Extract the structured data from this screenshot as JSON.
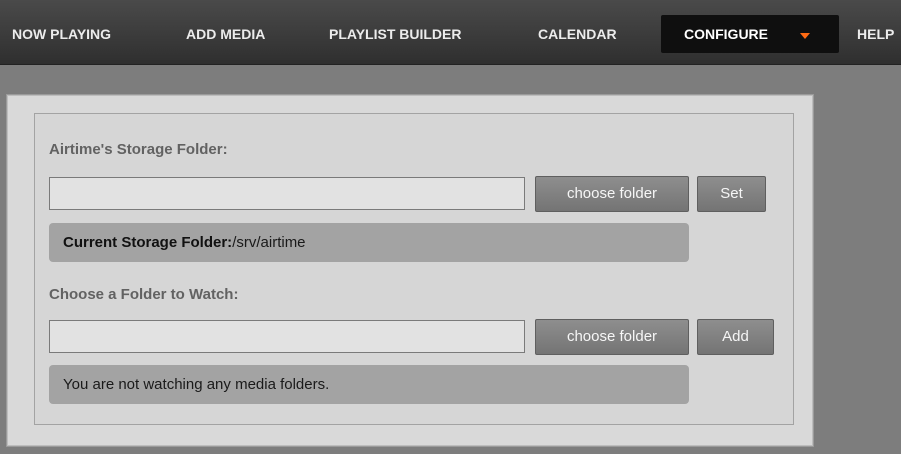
{
  "nav": {
    "items": [
      {
        "label": "NOW PLAYING"
      },
      {
        "label": "ADD MEDIA"
      },
      {
        "label": "PLAYLIST BUILDER"
      },
      {
        "label": "CALENDAR"
      },
      {
        "label": "CONFIGURE",
        "active": true
      },
      {
        "label": "HELP"
      }
    ],
    "accent_color": "#ff6a13"
  },
  "storage": {
    "heading": "Airtime's Storage Folder:",
    "input_value": "",
    "choose_button": "choose folder",
    "set_button": "Set",
    "current_label": "Current Storage Folder:",
    "current_value": "/srv/airtime"
  },
  "watch": {
    "heading": "Choose a Folder to Watch:",
    "input_value": "",
    "choose_button": "choose folder",
    "add_button": "Add",
    "status": "You are not watching any media folders."
  }
}
